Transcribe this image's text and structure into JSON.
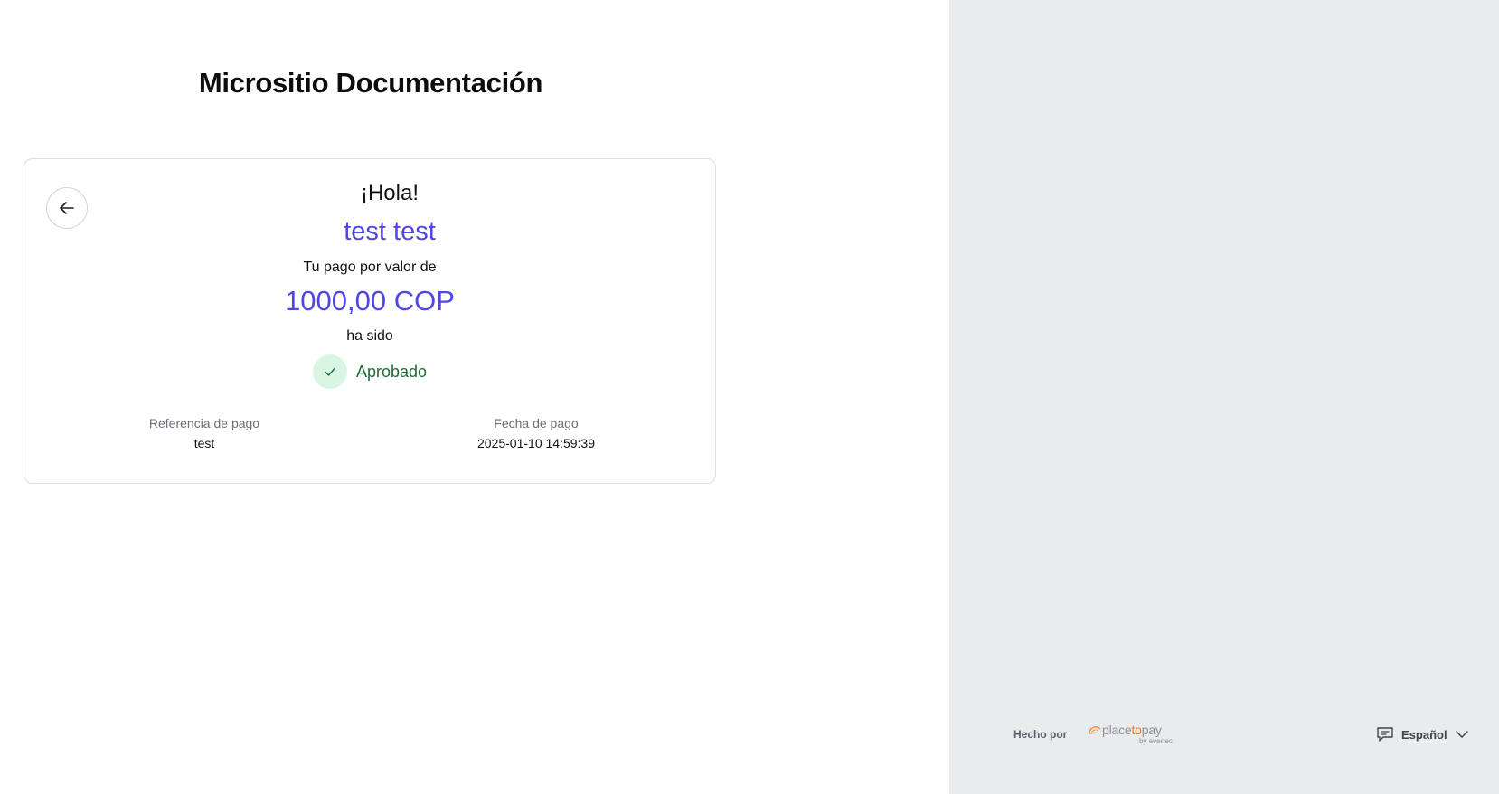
{
  "site": {
    "title": "Micrositio Documentación"
  },
  "result": {
    "greeting": "¡Hola!",
    "customer_name": "test test",
    "amount_intro": "Tu pago por valor de",
    "amount": "1000,00 COP",
    "status_intro": "ha sido",
    "status": "Aprobado",
    "status_color": "#1f6b36",
    "status_icon": "check-icon",
    "accent_color": "#4f46e5",
    "details": {
      "reference_label": "Referencia de pago",
      "reference_value": "test",
      "date_label": "Fecha de pago",
      "date_value": "2025-01-10 14:59:39"
    },
    "back_icon": "arrow-left-icon"
  },
  "footer": {
    "made_by": "Hecho por",
    "brand_prefix": "place",
    "brand_to": "to",
    "brand_suffix": "pay",
    "brand_sub": "by evertec",
    "language": "Español",
    "language_icon": "chat-icon",
    "dropdown_icon": "chevron-down-icon"
  }
}
